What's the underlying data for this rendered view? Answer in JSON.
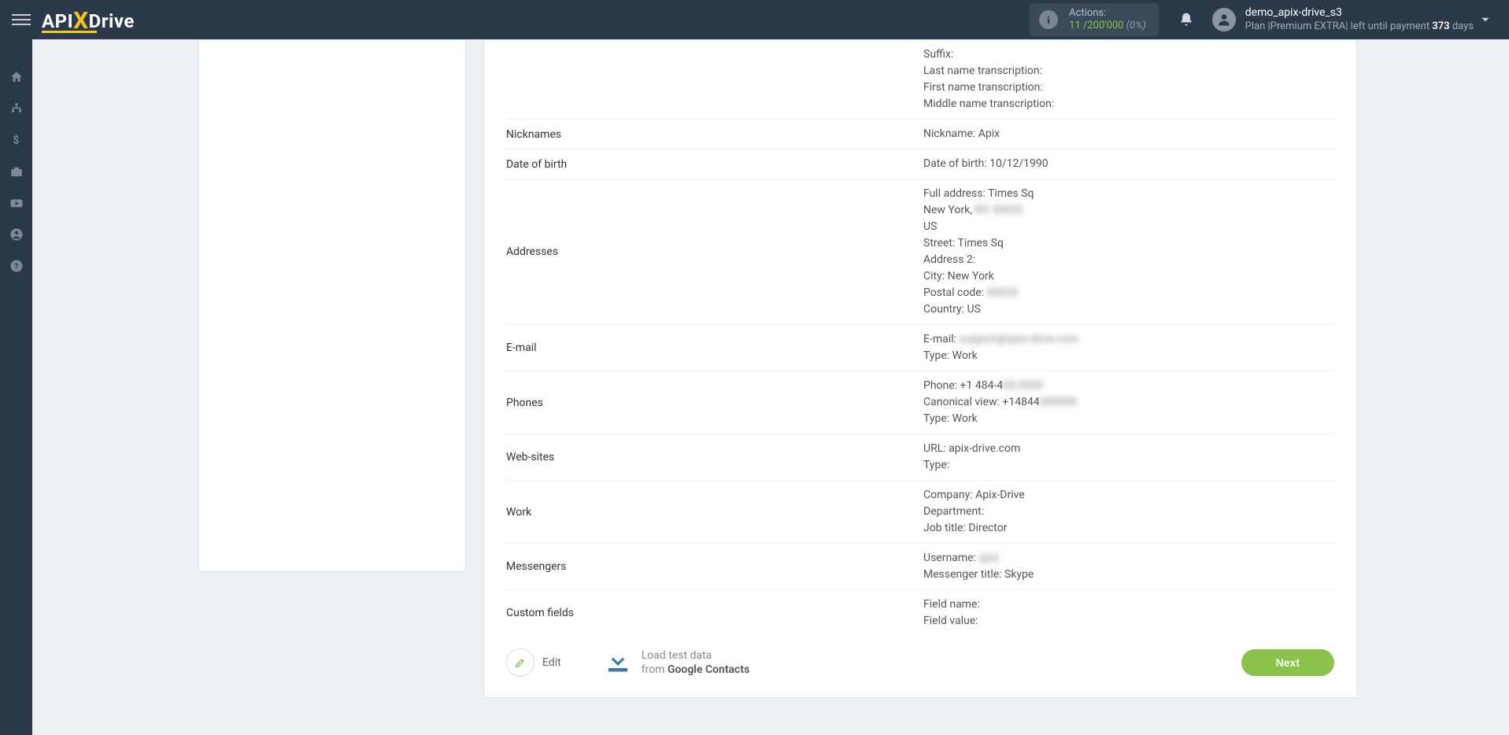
{
  "header": {
    "actions_label": "Actions:",
    "actions_used": "11",
    "actions_sep": "/",
    "actions_limit": "200'000",
    "actions_pct": "(0%)",
    "username": "demo_apix-drive_s3",
    "plan_prefix": "Plan |",
    "plan_name": "Premium EXTRA",
    "plan_sep": "|",
    "plan_left": "left until payment",
    "plan_days": "373",
    "plan_days_suffix": "days"
  },
  "rows": [
    {
      "label": "",
      "lines": [
        "Suffix:",
        "Last name transcription:",
        "First name transcription:",
        "Middle name transcription:"
      ],
      "noborder": false
    },
    {
      "label": "Nicknames",
      "lines": [
        "Nickname: Apix"
      ]
    },
    {
      "label": "Date of birth",
      "lines": [
        "Date of birth: 10/12/1990"
      ]
    },
    {
      "label": "Addresses",
      "lines": [
        "Full address: Times Sq",
        {
          "text": "New York, ",
          "blur": "NY 40020"
        },
        "US",
        "Street: Times Sq",
        "Address 2:",
        "City: New York",
        {
          "text": "Postal code: ",
          "blur": "40020"
        },
        "Country: US"
      ]
    },
    {
      "label": "E-mail",
      "lines": [
        {
          "text": "E-mail: ",
          "blur": "support@apix-drive.com"
        },
        "Type: Work"
      ]
    },
    {
      "label": "Phones",
      "lines": [
        {
          "text": "Phone: +1 484-4",
          "blur": "00-0000"
        },
        {
          "text": "Canonical view: +14844",
          "blur": "000000"
        },
        "Type: Work"
      ]
    },
    {
      "label": "Web-sites",
      "lines": [
        "URL: apix-drive.com",
        "Type:"
      ]
    },
    {
      "label": "Work",
      "lines": [
        "Company: Apix-Drive",
        "Department:",
        "Job title: Director"
      ]
    },
    {
      "label": "Messengers",
      "lines": [
        {
          "text": "Username: ",
          "blur": "apix"
        },
        "Messenger title: Skype"
      ]
    },
    {
      "label": "Custom fields",
      "lines": [
        "Field name:",
        "Field value:"
      ],
      "noborder": true
    }
  ],
  "buttons": {
    "edit": "Edit",
    "load_line1": "Load test data",
    "load_line2_prefix": "from ",
    "load_line2_bold": "Google Contacts",
    "next": "Next"
  },
  "logo": {
    "part1": "API",
    "partX": "X",
    "part2": "Drive"
  }
}
